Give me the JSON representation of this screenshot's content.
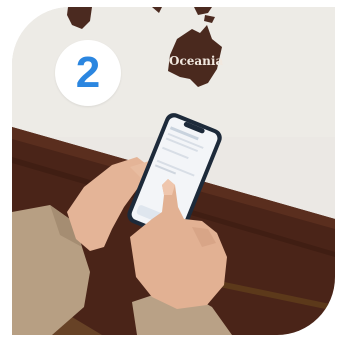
{
  "step_badge": {
    "number": "2",
    "color": "#2b86e0"
  },
  "wall_sign": {
    "text": "Oceania"
  },
  "photo": {
    "colors": {
      "wall": "#ece9e5",
      "wood_panel": "#4a2418",
      "sleeve": "#b79f83",
      "skin": "#e6b99c",
      "phone_body": "#1d2a3a",
      "phone_screen": "#f3f5f8"
    }
  }
}
